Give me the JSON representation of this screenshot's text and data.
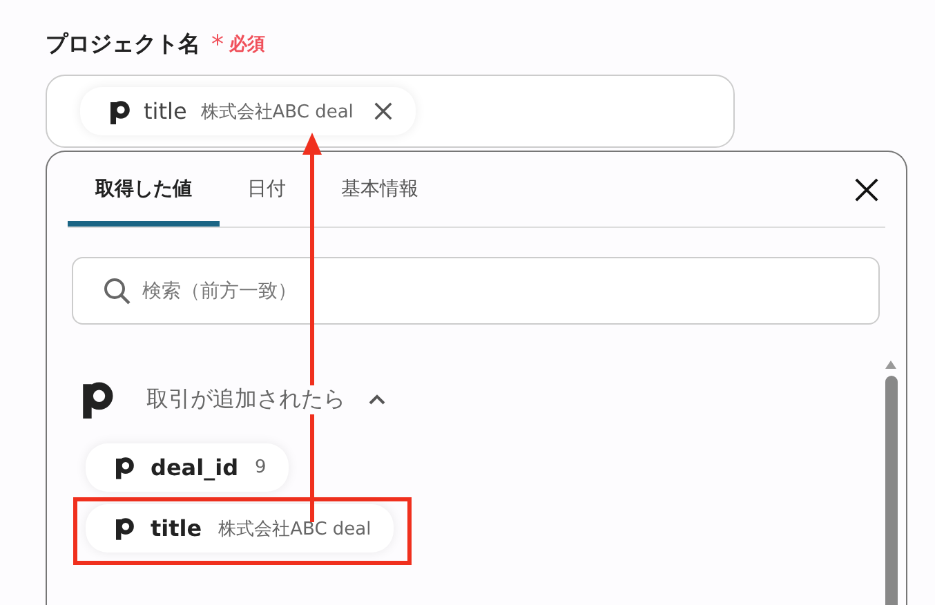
{
  "field": {
    "label": "プロジェクト名",
    "required_mark": "*",
    "required_text": "必須",
    "chip": {
      "name": "title",
      "value": "株式会社ABC deal"
    }
  },
  "panel": {
    "tabs": [
      {
        "label": "取得した値",
        "selected": true
      },
      {
        "label": "日付",
        "selected": false
      },
      {
        "label": "基本情報",
        "selected": false
      }
    ],
    "search": {
      "placeholder": "検索（前方一致）"
    },
    "group": {
      "title": "取引が追加されたら",
      "expanded": true,
      "items": [
        {
          "name": "deal_id",
          "value": "9",
          "highlighted": false
        },
        {
          "name": "title",
          "value": "株式会社ABC deal",
          "highlighted": true
        }
      ]
    }
  }
}
